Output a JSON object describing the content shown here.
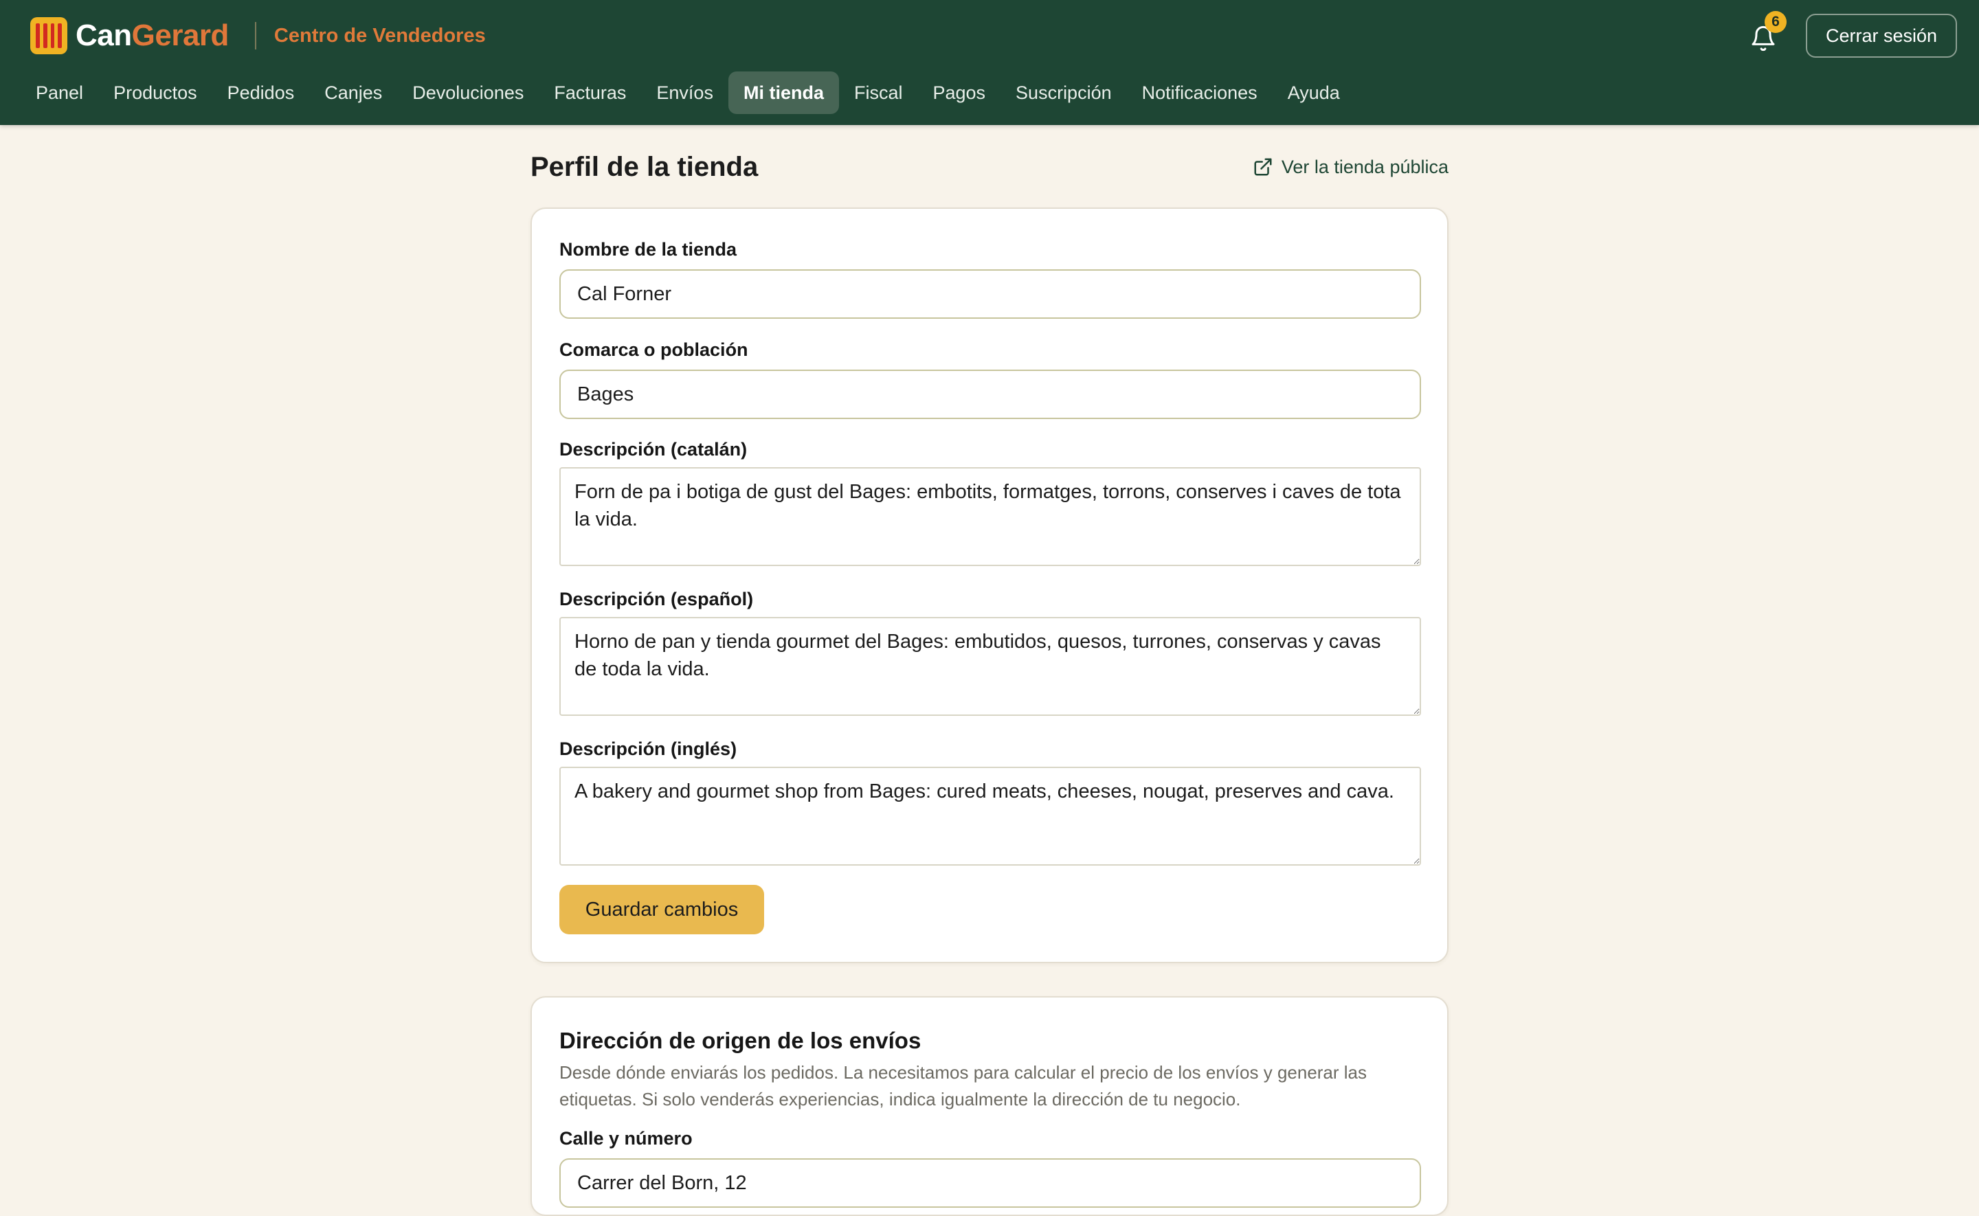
{
  "header": {
    "brand_can": "Can",
    "brand_gerard": "Gerard",
    "portal_title": "Centro de Vendedores",
    "notification_count": "6",
    "logout_label": "Cerrar sesión"
  },
  "nav": {
    "items": [
      {
        "label": "Panel"
      },
      {
        "label": "Productos"
      },
      {
        "label": "Pedidos"
      },
      {
        "label": "Canjes"
      },
      {
        "label": "Devoluciones"
      },
      {
        "label": "Facturas"
      },
      {
        "label": "Envíos"
      },
      {
        "label": "Mi tienda",
        "active": true
      },
      {
        "label": "Fiscal"
      },
      {
        "label": "Pagos"
      },
      {
        "label": "Suscripción"
      },
      {
        "label": "Notificaciones"
      },
      {
        "label": "Ayuda"
      }
    ]
  },
  "page": {
    "title": "Perfil de la tienda",
    "public_link": "Ver la tienda pública"
  },
  "profile_form": {
    "store_name_label": "Nombre de la tienda",
    "store_name_value": "Cal Forner",
    "region_label": "Comarca o población",
    "region_value": "Bages",
    "desc_ca_label": "Descripción (catalán)",
    "desc_ca_value": "Forn de pa i botiga de gust del Bages: embotits, formatges, torrons, conserves i caves de tota la vida.",
    "desc_es_label": "Descripción (español)",
    "desc_es_value": "Horno de pan y tienda gourmet del Bages: embutidos, quesos, turrones, conservas y cavas de toda la vida.",
    "desc_en_label": "Descripción (inglés)",
    "desc_en_value": "A bakery and gourmet shop from Bages: cured meats, cheeses, nougat, preserves and cava.",
    "save_label": "Guardar cambios"
  },
  "shipping_origin": {
    "title": "Dirección de origen de los envíos",
    "description": "Desde dónde enviarás los pedidos. La necesitamos para calcular el precio de los envíos y generar las etiquetas. Si solo venderás experiencias, indica igualmente la dirección de tu negocio.",
    "street_label": "Calle y número",
    "street_value": "Carrer del Born, 12"
  },
  "colors": {
    "header_bg": "#1e4634",
    "accent_orange": "#e0773a",
    "accent_yellow": "#e9b94f",
    "page_bg": "#f8f3ea"
  },
  "icons": {
    "logo": "senyera-logo-icon",
    "bell": "bell-icon",
    "external_link": "external-link-icon"
  }
}
